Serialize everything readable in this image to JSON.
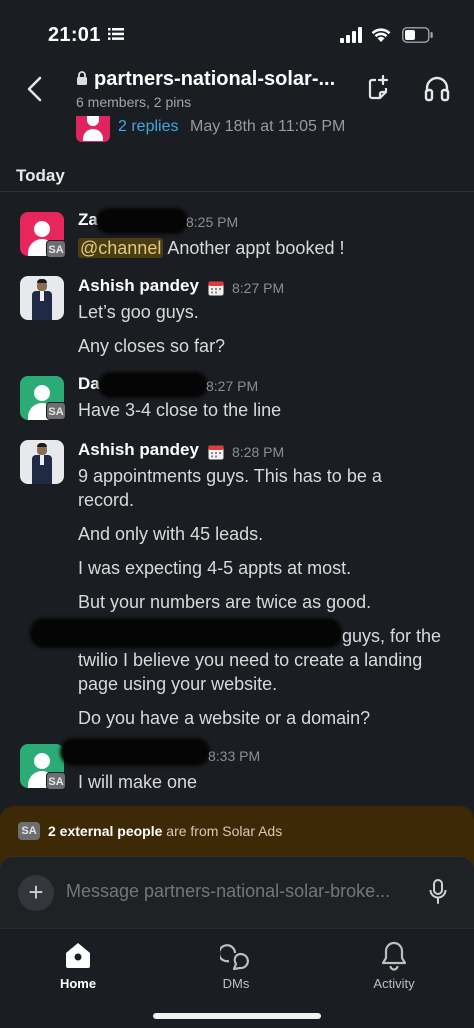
{
  "status_bar": {
    "time": "21:01"
  },
  "header": {
    "channel_name": "partners-national-solar-...",
    "subtitle": "6 members, 2 pins"
  },
  "previous_thread": {
    "replies": "2 replies",
    "date": "May 18th at 11:05 PM"
  },
  "day_divider": "Today",
  "messages": [
    {
      "author": "Za",
      "time": "8:25 PM",
      "external_badge": "SA",
      "lines": [
        "@channel",
        " Another appt booked !"
      ]
    },
    {
      "author": "Ashish pandey",
      "time": "8:27 PM",
      "lines": [
        "Let’s goo guys.",
        "Any closes so far?"
      ]
    },
    {
      "author": "Da",
      "time": "8:27 PM",
      "external_badge": "SA",
      "lines": [
        "Have 3-4 close to the line"
      ]
    },
    {
      "author": "Ashish pandey",
      "time": "8:28 PM",
      "lines": [
        "9 appointments guys. This has to be a",
        "record.",
        "And only with 45 leads.",
        "I was expecting 4-5 appts at most.",
        "But your numbers are twice as good.",
        "guys, for the",
        "twilio I believe you need to create a landing",
        "page using your website.",
        "Do you have a website or a domain?"
      ]
    },
    {
      "author": "",
      "time": "8:33 PM",
      "external_badge": "SA",
      "lines": [
        "I will make one"
      ]
    }
  ],
  "external_banner": {
    "badge": "SA",
    "bold": "2 external people",
    "rest": " are from Solar Ads"
  },
  "composer": {
    "placeholder": "Message partners-national-solar-broke..."
  },
  "tabs": [
    {
      "label": "Home",
      "icon": "home-icon",
      "active": true
    },
    {
      "label": "DMs",
      "icon": "dms-icon",
      "active": false
    },
    {
      "label": "Activity",
      "icon": "bell-icon",
      "active": false
    }
  ],
  "colors": {
    "background": "#1a1d21",
    "link": "#3ea8e4",
    "external_banner": "#3e2907",
    "avatar_red": "#e8265e",
    "avatar_green": "#2bac76"
  }
}
